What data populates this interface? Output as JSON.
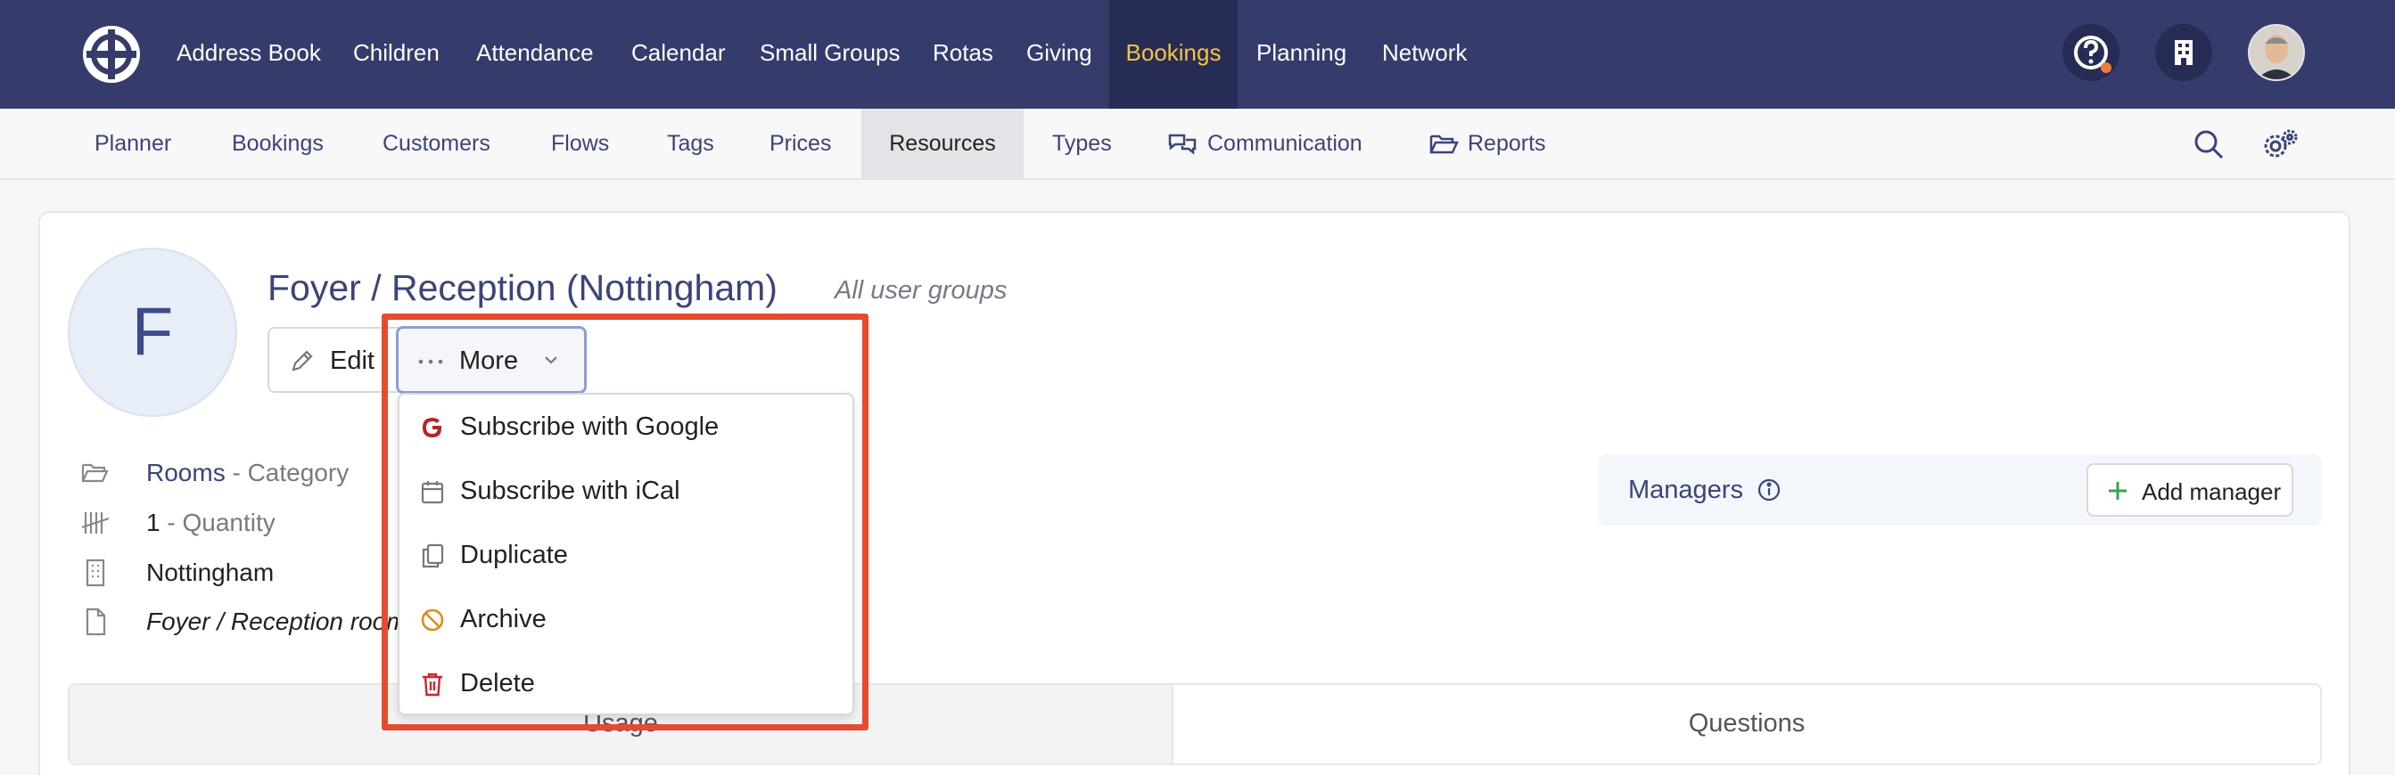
{
  "topnav": {
    "items": [
      {
        "label": "Address Book"
      },
      {
        "label": "Children"
      },
      {
        "label": "Attendance"
      },
      {
        "label": "Calendar"
      },
      {
        "label": "Small Groups"
      },
      {
        "label": "Rotas"
      },
      {
        "label": "Giving"
      },
      {
        "label": "Bookings",
        "active": true
      },
      {
        "label": "Planning"
      },
      {
        "label": "Network"
      }
    ],
    "icons": [
      "help-icon",
      "building-icon",
      "user-avatar"
    ]
  },
  "subnav": {
    "items": [
      {
        "label": "Planner"
      },
      {
        "label": "Bookings"
      },
      {
        "label": "Customers"
      },
      {
        "label": "Flows"
      },
      {
        "label": "Tags"
      },
      {
        "label": "Prices"
      },
      {
        "label": "Resources",
        "active": true
      },
      {
        "label": "Types"
      },
      {
        "label": "Communication"
      },
      {
        "label": "Reports"
      }
    ]
  },
  "resource": {
    "initial": "F",
    "title": "Foyer / Reception (Nottingham)",
    "subtitle": "All user groups",
    "edit_label": "Edit",
    "more_label": "More",
    "details": {
      "category_value": "Rooms",
      "category_label": "- Category",
      "quantity_value": "1",
      "quantity_label": "- Quantity",
      "location": "Nottingham",
      "description": "Foyer / Reception room"
    }
  },
  "managers": {
    "label": "Managers",
    "add_label": "Add manager"
  },
  "tabs": [
    {
      "label": "Usage",
      "active": true
    },
    {
      "label": "Questions"
    }
  ],
  "dropdown": {
    "items": [
      {
        "label": "Subscribe with Google",
        "icon": "google-icon"
      },
      {
        "label": "Subscribe with iCal",
        "icon": "calendar-icon"
      },
      {
        "label": "Duplicate",
        "icon": "copy-icon"
      },
      {
        "label": "Archive",
        "icon": "archive-icon"
      },
      {
        "label": "Delete",
        "icon": "trash-icon"
      }
    ]
  },
  "colors": {
    "nav_bg": "#353c6c",
    "nav_active_bg": "#262c54",
    "nav_active_text": "#f5c343",
    "link": "#3b447a",
    "highlight": "#e54b2f"
  }
}
